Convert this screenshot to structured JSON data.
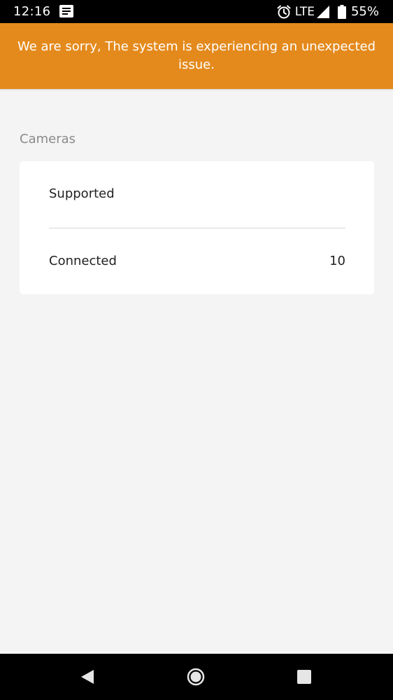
{
  "status_bar": {
    "time": "12:16",
    "network": "LTE",
    "battery": "55%",
    "icons": [
      "notification-icon",
      "alarm-icon",
      "signal-icon",
      "battery-icon"
    ]
  },
  "banner": {
    "message": "We are sorry, The system is experiencing an unexpected issue.",
    "color": "#e48a1c"
  },
  "cameras": {
    "header": "Cameras",
    "rows": [
      {
        "label": "Supported",
        "value": ""
      },
      {
        "label": "Connected",
        "value": "10"
      }
    ]
  },
  "nav_bar": {
    "icons": [
      "back-icon",
      "home-icon",
      "recents-icon"
    ]
  }
}
